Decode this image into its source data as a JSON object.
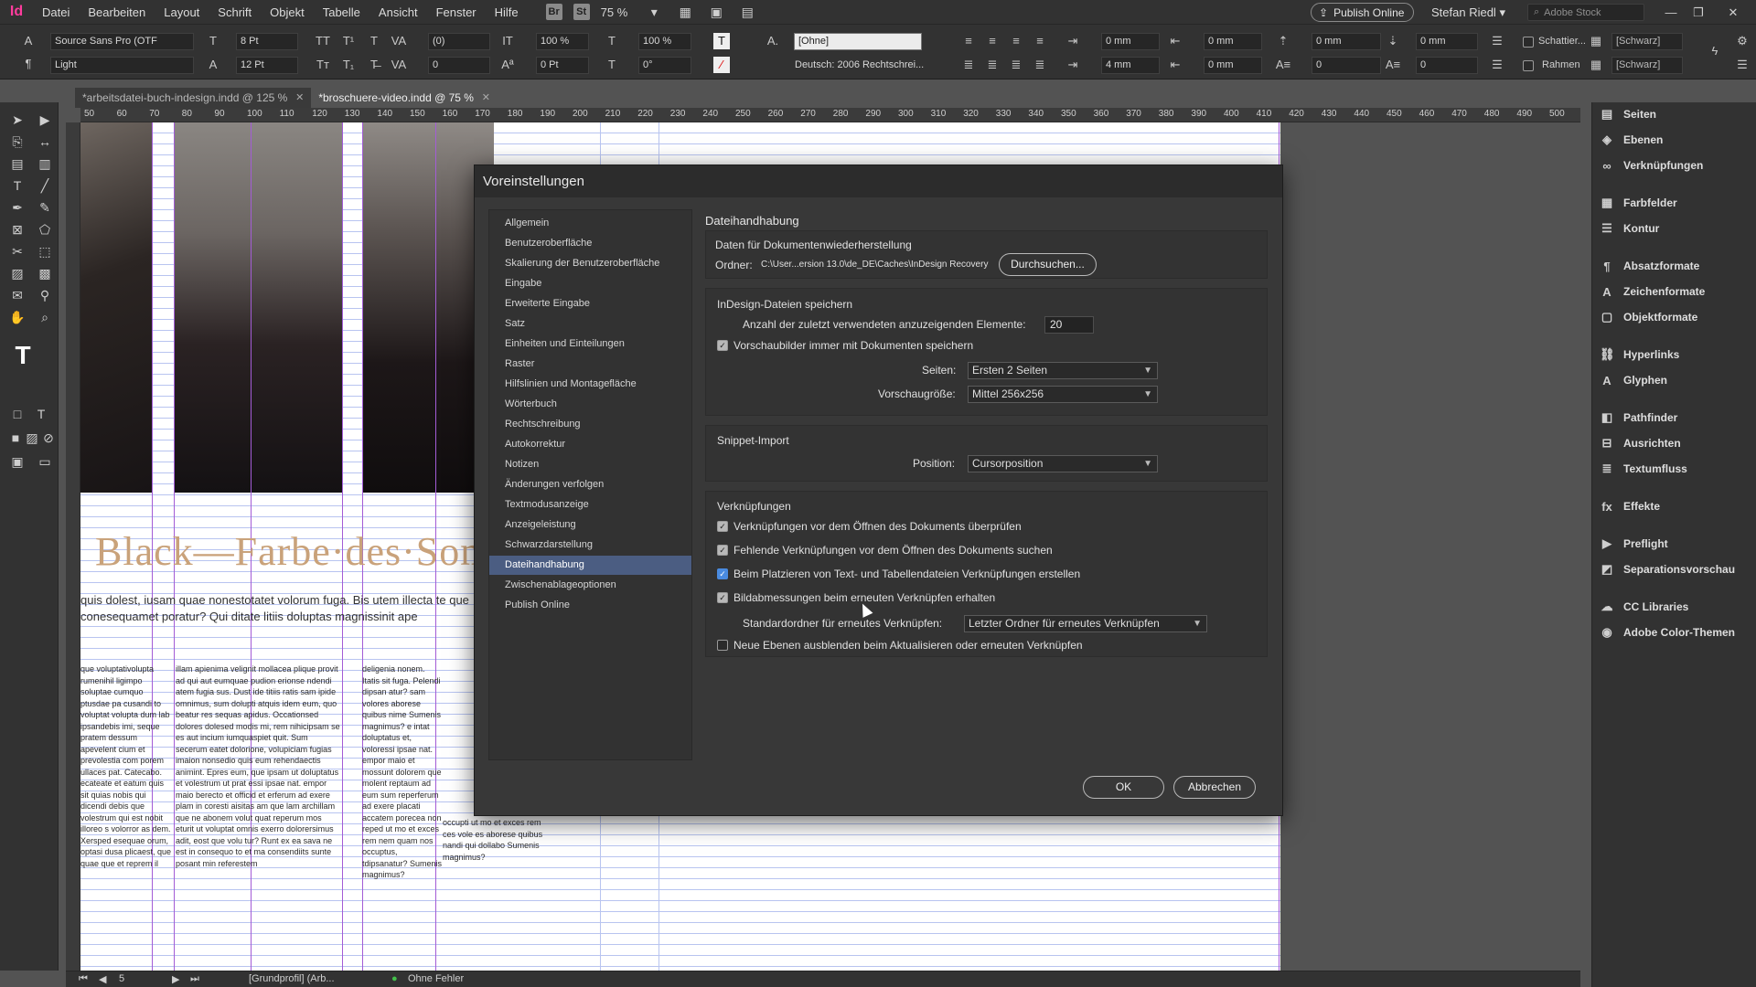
{
  "menubar": {
    "logo": "Id",
    "items": [
      "Datei",
      "Bearbeiten",
      "Layout",
      "Schrift",
      "Objekt",
      "Tabelle",
      "Ansicht",
      "Fenster",
      "Hilfe"
    ],
    "bridge": "Br",
    "stock": "St",
    "zoom": "75 %",
    "publish": "Publish Online",
    "user": "Stefan Riedl",
    "search_placeholder": "Adobe Stock"
  },
  "control": {
    "font": "Source Sans Pro (OTF",
    "style": "Light",
    "size": "8 Pt",
    "leading": "12 Pt",
    "tracking": "(0)",
    "kerning": "0",
    "hscale": "100 %",
    "vscale": "100 %",
    "baseline": "0 Pt",
    "skew": "0°",
    "char_style": "[Ohne]",
    "language": "Deutsch: 2006 Rechtschrei...",
    "mm1": "0 mm",
    "mm2": "0 mm",
    "mm3": "0 mm",
    "mm4": "0 mm",
    "mm5": "4 mm",
    "mm6": "0 mm",
    "n1": "0",
    "n2": "0",
    "shade": "Schattier...",
    "frame": "Rahmen",
    "color1": "[Schwarz]",
    "color2": "[Schwarz]"
  },
  "tabs": [
    {
      "label": "*arbeitsdatei-buch-indesign.indd @ 125 %",
      "active": false
    },
    {
      "label": "*broschuere-video.indd @ 75 %",
      "active": true
    }
  ],
  "ruler": [
    "50",
    "60",
    "70",
    "80",
    "90",
    "100",
    "110",
    "120",
    "130",
    "140",
    "150",
    "160",
    "170",
    "180",
    "190",
    "200",
    "210",
    "220",
    "230",
    "240",
    "250",
    "260",
    "270",
    "280",
    "290",
    "300",
    "310",
    "320",
    "330",
    "340",
    "350",
    "360",
    "370",
    "380",
    "390",
    "400",
    "410",
    "420",
    "430",
    "440",
    "450",
    "460",
    "470",
    "480",
    "490",
    "500"
  ],
  "document": {
    "headline": "Black—Farbe·des·Somm",
    "lead": "quis dolest, iusam quae nonestotatet volorum fuga. Bis utem illecta te que conesequamet poratur? Qui ditate litiis doluptas magnissinit ape",
    "col1": "que voluptativolupta rumenihil ligimpo soluptae cumquo ptusdae pa cusandi to voluptat volupta dum lab ipsandebis imi, seque pratem dessum apevelent cium et prevolestia com porem ullaces pat. Catecabo. ecateate et eatum quis sit quias nobis qui dicendi debis que volestrum qui est nobit illoreo s volorror as dem. Xersped esequae orum, optasi dusa plicaest, que quae que et reprem il",
    "col2": "illam apienima velignit mollacea plique provit ad qui aut eumquae pudion erionse ndendi atem fugia sus. Dust ide titiis ratis sam ipide omnimus, sum dolupti atquis idem eum, quo beatur res sequas apidus. Occationsed dolores dolesed modis mi, rem nihicipsam se es aut incium iumquaspiet quit. Sum secerum eatet dolorione, volupiciam fugias imaion nonsedio quis eum rehendaectis animint. Epres eum, que ipsam ut doluptatus et volestrum ut prat essi ipsae nat. empor maio berecto et officid et erferum ad exere plam in coresti aisitas am que lam archillam que ne abonem volut quat reperum mos eturit ut voluptat omnis exerro dolorersimus adit, eost que volu tur? Runt ex ea sava ne est in consequo to et ma consendiits sunte posant min referestem",
    "col3": "deligenia nonem. Itatis sit fuga. Pelendi dipsan atur? sam volores aborese quibus nime Sumenis magnimus? e intat doluptatus et, voloressi ipsae nat. empor maio et mossunt dolorem que molent reptaum ad eum sum reperferum ad exere placati accatem porecea non reped ut mo et exces rem nem quam nos occuptus, tdipsanatur? Sumenis magnimus?",
    "col4": "occupti ut mo et exces rem ces vole es aborese quibus nandi qui dollabo Sumenis magnimus?"
  },
  "panels": [
    "Seiten",
    "Ebenen",
    "Verknüpfungen",
    "Farbfelder",
    "Kontur",
    "Absatzformate",
    "Zeichenformate",
    "Objektformate",
    "Hyperlinks",
    "Glyphen",
    "Pathfinder",
    "Ausrichten",
    "Textumfluss",
    "Effekte",
    "Preflight",
    "Separationsvorschau",
    "CC Libraries",
    "Adobe Color-Themen"
  ],
  "status": {
    "page": "5",
    "profile": "[Grundprofil] (Arb...",
    "errors": "Ohne Fehler"
  },
  "dialog": {
    "title": "Voreinstellungen",
    "nav": [
      "Allgemein",
      "Benutzeroberfläche",
      "Skalierung der Benutzeroberfläche",
      "Eingabe",
      "Erweiterte Eingabe",
      "Satz",
      "Einheiten und Einteilungen",
      "Raster",
      "Hilfslinien und Montagefläche",
      "Wörterbuch",
      "Rechtschreibung",
      "Autokorrektur",
      "Notizen",
      "Änderungen verfolgen",
      "Textmodusanzeige",
      "Anzeigeleistung",
      "Schwarzdarstellung",
      "Dateihandhabung",
      "Zwischenablageoptionen",
      "Publish Online"
    ],
    "active_nav": "Dateihandhabung",
    "section": "Dateihandhabung",
    "recovery": {
      "title": "Daten für Dokumentenwiederherstellung",
      "folder_label": "Ordner:",
      "folder_path": "C:\\User...ersion 13.0\\de_DE\\Caches\\InDesign Recovery",
      "browse": "Durchsuchen..."
    },
    "save": {
      "title": "InDesign-Dateien speichern",
      "recent_label": "Anzahl der zuletzt verwendeten anzuzeigenden Elemente:",
      "recent_value": "20",
      "preview_label": "Vorschaubilder immer mit Dokumenten speichern",
      "pages_label": "Seiten:",
      "pages_value": "Ersten 2 Seiten",
      "size_label": "Vorschaugröße:",
      "size_value": "Mittel 256x256"
    },
    "snippet": {
      "title": "Snippet-Import",
      "pos_label": "Position:",
      "pos_value": "Cursorposition"
    },
    "links": {
      "title": "Verknüpfungen",
      "items": [
        {
          "label": "Verknüpfungen vor dem Öffnen des Dokuments überprüfen",
          "checked": true
        },
        {
          "label": "Fehlende Verknüpfungen vor dem Öffnen des Dokuments suchen",
          "checked": true
        },
        {
          "label": "Beim Platzieren von Text- und Tabellendateien Verknüpfungen erstellen",
          "checked": true
        },
        {
          "label": "Bildabmessungen beim erneuten Verknüpfen erhalten",
          "checked": true
        }
      ],
      "default_label": "Standardordner für erneutes Verknüpfen:",
      "default_value": "Letzter Ordner für erneutes Verknüpfen",
      "hide_label": "Neue Ebenen ausblenden beim Aktualisieren oder erneuten Verknüpfen",
      "hide_checked": false
    },
    "ok": "OK",
    "cancel": "Abbrechen"
  }
}
